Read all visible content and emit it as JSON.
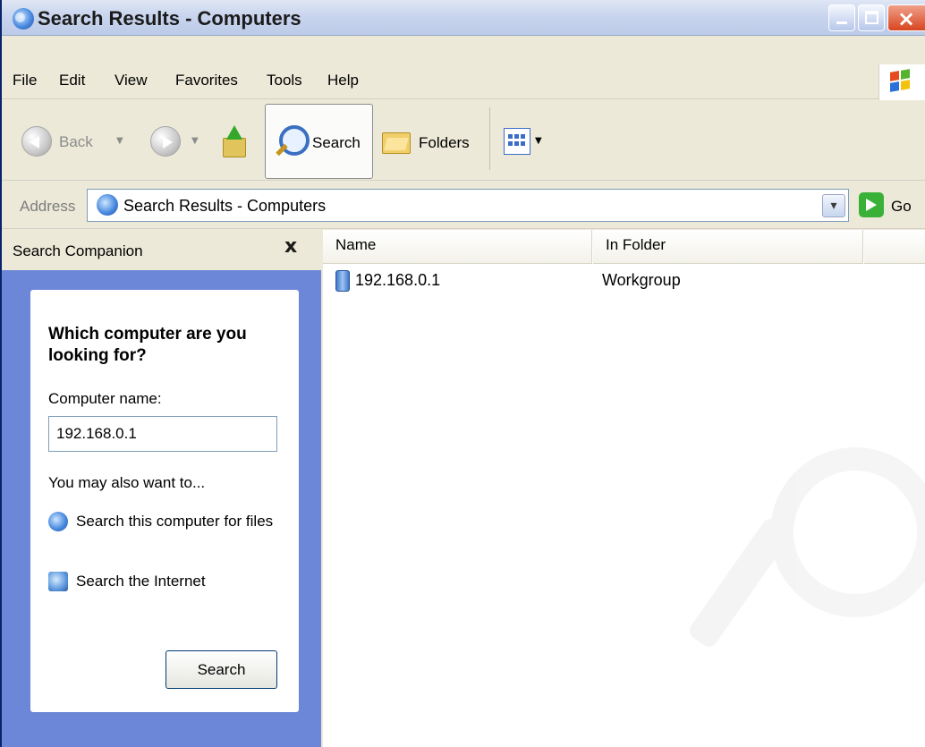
{
  "window": {
    "title": "Search Results - Computers"
  },
  "menu": {
    "items": [
      "File",
      "Edit",
      "View",
      "Favorites",
      "Tools",
      "Help"
    ]
  },
  "toolbar": {
    "back_label": "Back",
    "search_label": "Search",
    "folders_label": "Folders"
  },
  "address": {
    "label": "Address",
    "value": "Search Results - Computers",
    "go_label": "Go"
  },
  "left_pane": {
    "title": "Search Companion",
    "close_glyph": "x",
    "heading": "Which computer are you looking for?",
    "field_label": "Computer name:",
    "field_value": "192.168.0.1",
    "also_label": "You may also want to...",
    "links": [
      {
        "label": "Search this computer for files"
      },
      {
        "label": "Search the Internet"
      }
    ],
    "search_button": "Search"
  },
  "results": {
    "columns": [
      "Name",
      "In Folder"
    ],
    "rows": [
      {
        "name": "192.168.0.1",
        "folder": "Workgroup"
      }
    ]
  },
  "colors": {
    "pane_blue": "#6d87d8",
    "chrome": "#ece9d8",
    "close_red": "#d8451f",
    "go_green": "#39b138"
  },
  "icons": {
    "title": "search-globe-icon",
    "back": "back-arrow-icon",
    "forward": "forward-arrow-icon",
    "up": "folder-up-icon",
    "search": "magnifier-icon",
    "folders": "folder-icon",
    "views": "views-grid-icon",
    "go": "go-arrow-icon",
    "computer": "computer-icon"
  }
}
